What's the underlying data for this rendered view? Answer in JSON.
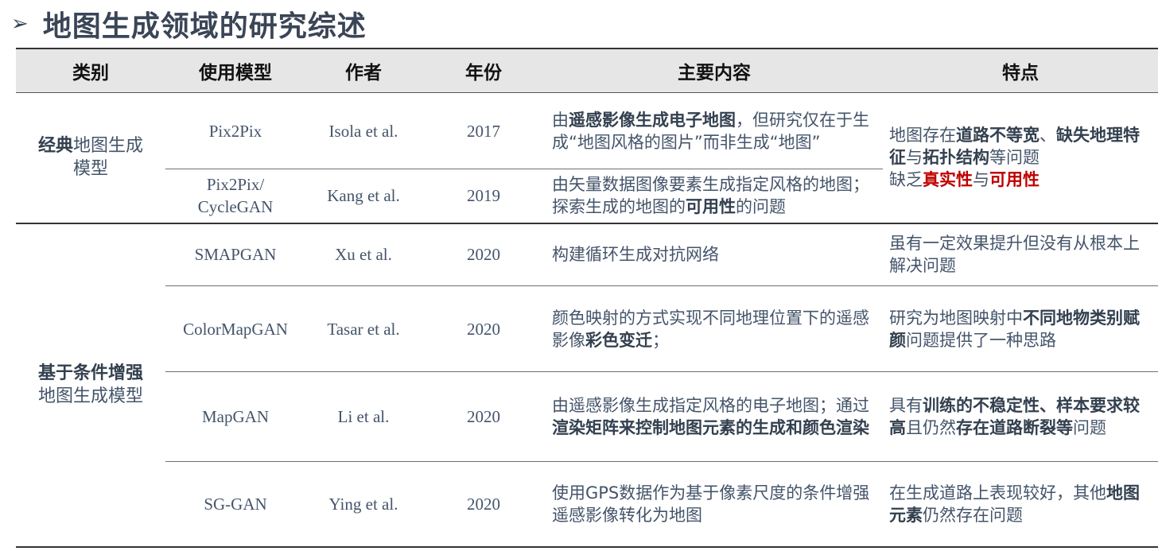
{
  "title": "地图生成领域的研究综述",
  "title_icon": "arrow-right-icon",
  "headers": [
    "类别",
    "使用模型",
    "作者",
    "年份",
    "主要内容",
    "特点"
  ],
  "categories": {
    "classic": {
      "bold": "经典",
      "line1_rest": "地图生成",
      "line2": "模型"
    },
    "conditional": {
      "line1": "基于条件增强",
      "line2": "地图生成模型"
    }
  },
  "rows": [
    {
      "model": "Pix2Pix",
      "author": "Isola et al.",
      "year": "2017",
      "content": [
        {
          "t": "由"
        },
        {
          "t": "遥感影像生成电子地图",
          "b": true
        },
        {
          "t": "，但研究仅在于生成“地图风格的图片”而非生成“地图”"
        }
      ]
    },
    {
      "model_line1": "Pix2Pix/",
      "model_line2": "CycleGAN",
      "author": "Kang et al.",
      "year": "2019",
      "content": [
        {
          "t": "由矢量数据图像要素生成指定风格的地图；探索生成的地图的"
        },
        {
          "t": "可用性",
          "b": true
        },
        {
          "t": "的问题"
        }
      ]
    },
    {
      "model": "SMAPGAN",
      "author": "Xu et al.",
      "year": "2020",
      "content": [
        {
          "t": "构建循环生成对抗网络"
        }
      ],
      "feature": [
        {
          "t": "虽有一定效果提升但没有从根本上解决问题"
        }
      ]
    },
    {
      "model": "ColorMapGAN",
      "author": "Tasar et al.",
      "year": "2020",
      "content": [
        {
          "t": "颜色映射的方式实现不同地理位置下的遥感影像"
        },
        {
          "t": "彩色变迁",
          "b": true
        },
        {
          "t": "；"
        }
      ],
      "feature": [
        {
          "t": "研究为地图映射中"
        },
        {
          "t": "不同地物类别赋颜",
          "b": true
        },
        {
          "t": "问题提供了一种思路"
        }
      ]
    },
    {
      "model": "MapGAN",
      "author": "Li et al.",
      "year": "2020",
      "content": [
        {
          "t": "由遥感影像生成指定风格的电子地图；通过"
        },
        {
          "t": "渲染矩阵来控制地图元素的生成和颜色渲染",
          "b": true
        }
      ],
      "feature": [
        {
          "t": "具有"
        },
        {
          "t": "训练的不稳定性、样本要求较高",
          "b": true
        },
        {
          "t": "且仍然"
        },
        {
          "t": "存在道路断裂等",
          "b": true
        },
        {
          "t": "问题"
        }
      ]
    },
    {
      "model": "SG-GAN",
      "author": "Ying et al.",
      "year": "2020",
      "content": [
        {
          "t": "使用GPS数据作为基于像素尺度的条件增强遥感影像转化为地图"
        }
      ],
      "feature": [
        {
          "t": "在生成道路上表现较好，其他"
        },
        {
          "t": "地图元素",
          "b": true
        },
        {
          "t": "仍然存在问题"
        }
      ]
    }
  ],
  "classic_feature": [
    {
      "t": "地图存在"
    },
    {
      "t": "道路不等宽",
      "b": true
    },
    {
      "t": "、"
    },
    {
      "t": "缺失地理特征",
      "b": true
    },
    {
      "t": "与"
    },
    {
      "t": "拓扑结构",
      "b": true
    },
    {
      "t": "等问题"
    },
    {
      "br": true
    },
    {
      "t": "缺乏"
    },
    {
      "t": "真实性",
      "r": true
    },
    {
      "t": "与"
    },
    {
      "t": "可用性",
      "r": true
    }
  ]
}
